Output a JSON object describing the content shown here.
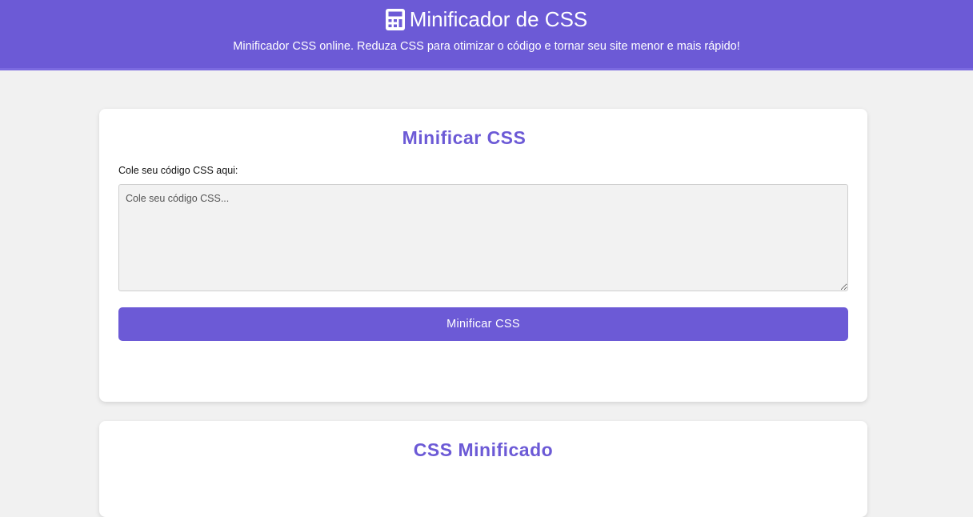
{
  "header": {
    "title": "Minificador de CSS",
    "subtitle": "Minificador CSS online. Reduza CSS para otimizar o código e tornar seu site menor e mais rápido!",
    "icon": "calculator-icon"
  },
  "minify_card": {
    "title": "Minificar CSS",
    "input_label": "Cole seu código CSS aqui:",
    "input_value": "",
    "input_placeholder": "Cole seu código CSS...",
    "button_label": "Minificar CSS"
  },
  "output_card": {
    "title": "CSS Minificado"
  },
  "colors": {
    "accent": "#6c5ad6",
    "page_background": "#f1f1f1",
    "card_background": "#ffffff",
    "input_background": "#f2f2f2"
  }
}
